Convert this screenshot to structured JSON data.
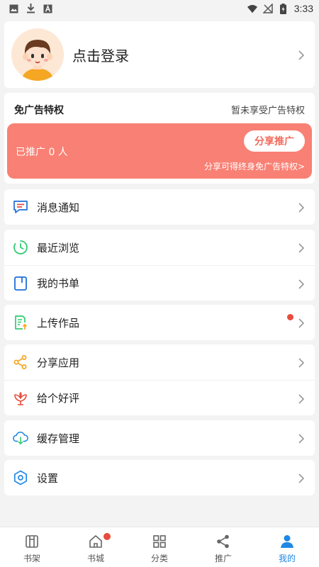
{
  "status_bar": {
    "time": "3:33",
    "left_icons": [
      "image-icon",
      "download-icon",
      "font-icon"
    ],
    "right_icons": [
      "wifi-icon",
      "no-signal-icon",
      "battery-icon"
    ]
  },
  "profile": {
    "login_text": "点击登录",
    "avatar": "avatar-cartoon-boy"
  },
  "adfree": {
    "title": "免广告特权",
    "status": "暂未享受广告特权",
    "promoted_count": "已推广 0 人",
    "share_button": "分享推广",
    "hint": "分享可得终身免广告特权>",
    "color": "#f98074"
  },
  "menu": {
    "group1": [
      {
        "label": "消息通知",
        "icon": "message-icon"
      }
    ],
    "group2": [
      {
        "label": "最近浏览",
        "icon": "clock-icon"
      },
      {
        "label": "我的书单",
        "icon": "booklist-icon"
      }
    ],
    "group3": [
      {
        "label": "上传作品",
        "icon": "upload-icon"
      }
    ],
    "group4": [
      {
        "label": "分享应用",
        "icon": "share-icon"
      },
      {
        "label": "给个好评",
        "icon": "flower-icon"
      }
    ],
    "group5": [
      {
        "label": "缓存管理",
        "icon": "cloud-download-icon"
      }
    ],
    "group6": [
      {
        "label": "设置",
        "icon": "gear-icon"
      }
    ]
  },
  "bottom_nav": [
    {
      "label": "书架",
      "icon": "bookshelf-icon"
    },
    {
      "label": "书城",
      "icon": "home-icon"
    },
    {
      "label": "分类",
      "icon": "grid-icon"
    },
    {
      "label": "推广",
      "icon": "share-icon"
    },
    {
      "label": "我的",
      "icon": "person-icon"
    }
  ],
  "colors": {
    "accent": "#1e88e5",
    "badge": "#e74c3c"
  }
}
